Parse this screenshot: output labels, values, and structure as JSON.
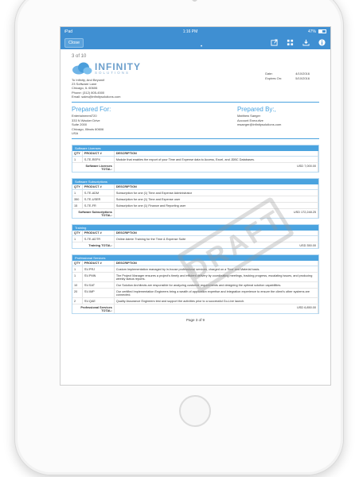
{
  "status_bar": {
    "carrier": "iPad",
    "time": "1:16 PM",
    "battery": "47%",
    "battery_level": 0.47
  },
  "toolbar": {
    "close_label": "Close",
    "dots": "•",
    "icons": [
      "export-icon",
      "grid-icon",
      "download-icon",
      "info-icon"
    ]
  },
  "document": {
    "page_indicator": "3 of 10",
    "logo": {
      "title": "INFINITY",
      "subtitle": "SOLUTIONS"
    },
    "dates": [
      {
        "label": "Date:",
        "value": "4/10/2016"
      },
      {
        "label": "Expires On:",
        "value": "5/10/2016"
      }
    ],
    "address_lines": [
      "To Infinity, And Beyond!",
      "23 Software Lane",
      "Chicago, IL 60606",
      "Phone: (312) 805-4500",
      "Email: sales@infinitysolutions.com"
    ],
    "prepared_for": {
      "heading": "Prepared For:",
      "lines": [
        "Entertainment720",
        "333 N Wacker Drive",
        "Suite 2000",
        "Chicago, Illinois 60606",
        "USA"
      ]
    },
    "prepared_by": {
      "heading": "Prepared By:,",
      "lines": [
        "Matthew Saeger",
        "Account Executive",
        "msaeger@infinitysolutions.com"
      ]
    },
    "columns": {
      "qty": "QTY",
      "product": "PRODUCT #",
      "description": "DESCRIPTION"
    },
    "sections": [
      {
        "title": "Software Licenses",
        "rows": [
          {
            "qty": "1",
            "product": "S-TE-REPX",
            "description": "Module that enables the export of your Time and Expense data to Access, Excel, and JDBC Databases."
          }
        ],
        "total_label": "Software Licenses TOTAL:",
        "total_value": "USD 7,000.00"
      },
      {
        "title": "Software Subscriptions",
        "rows": [
          {
            "qty": "1",
            "product": "S-TE-ADM",
            "description": "Subscription for one (1) Time and Expense Administrator"
          },
          {
            "qty": "350",
            "product": "S-TE-USER",
            "description": "Subscription for one (1) Time and Expense user"
          },
          {
            "qty": "15",
            "product": "S-TE-FR",
            "description": "Subscription for one (1) Finance and Reporting user"
          }
        ],
        "total_label": "Software Subscriptions TOTAL:",
        "total_value": "USD 172,248.25"
      },
      {
        "title": "Training",
        "rows": [
          {
            "qty": "1",
            "product": "S-TE-ADTR",
            "description": "Online Admin Training for the Time & Expense Suite"
          }
        ],
        "total_label": "Training TOTAL:",
        "total_value": "USD 350.00"
      },
      {
        "title": "Professional Services",
        "rows": [
          {
            "qty": "1",
            "product": "SV-PRJ",
            "description": "Custom Implementation managed by in-house professional services, charged on a Time and Material basis."
          },
          {
            "qty": "1",
            "product": "SV-PMN",
            "description": "The Project Manager ensures a project's timely and efficient delivery by coordinating meetings, tracking progress, escalating issues, and producing weekly status reports."
          },
          {
            "qty": "10",
            "product": "SV-SAT",
            "description": "Our Solution Architects are responsible for analyzing customer requirements and designing the optimal solution capabilities."
          },
          {
            "qty": "20",
            "product": "SV-IMP",
            "description": "Our certified Implementation Engineers bring a wealth of application expertise and integration experience to ensure the client's other systems are connected."
          },
          {
            "qty": "2",
            "product": "SV-QAE",
            "description": "Quality Assurance Engineers test and support the activities prior to a successful Go-Live launch."
          }
        ],
        "total_label": "Professional Services TOTAL:",
        "total_value": "USD 6,850.00"
      }
    ],
    "watermark": "DRAFT",
    "footer": "Page 3 of 9"
  }
}
